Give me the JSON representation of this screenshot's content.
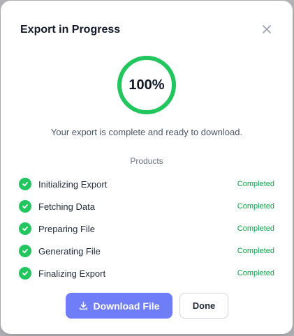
{
  "dialog": {
    "title": "Export in Progress",
    "close_icon": "close-icon"
  },
  "progress": {
    "percent_label": "100%",
    "value": 1.0,
    "color": "#22c55e",
    "message": "Your export is complete and ready to download.",
    "entity": "Products"
  },
  "steps": [
    {
      "label": "Initializing Export",
      "status": "Completed"
    },
    {
      "label": "Fetching Data",
      "status": "Completed"
    },
    {
      "label": "Preparing File",
      "status": "Completed"
    },
    {
      "label": "Generating File",
      "status": "Completed"
    },
    {
      "label": "Finalizing Export",
      "status": "Completed"
    }
  ],
  "actions": {
    "download_label": "Download File",
    "download_icon": "download-icon",
    "done_label": "Done"
  },
  "colors": {
    "accent": "#6f7ef8",
    "success": "#22c55e",
    "success_text": "#16a34a"
  }
}
